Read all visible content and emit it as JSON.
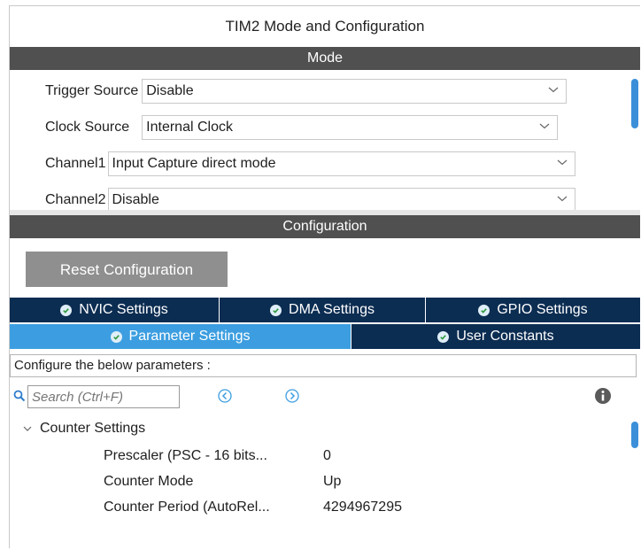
{
  "window": {
    "title": "TIM2 Mode and Configuration"
  },
  "mode": {
    "header": "Mode",
    "rows": [
      {
        "label": "Trigger Source",
        "value": "Disable"
      },
      {
        "label": "Clock Source",
        "value": "Internal Clock"
      },
      {
        "label": "Channel1",
        "value": "Input Capture direct mode"
      },
      {
        "label": "Channel2",
        "value": "Disable"
      }
    ]
  },
  "configuration": {
    "header": "Configuration",
    "reset_label": "Reset Configuration",
    "tabs_top": [
      {
        "label": "NVIC Settings",
        "icon": "check-circle-icon"
      },
      {
        "label": "DMA Settings",
        "icon": "check-circle-icon"
      },
      {
        "label": "GPIO Settings",
        "icon": "check-circle-icon"
      }
    ],
    "tabs_bottom": [
      {
        "label": "Parameter Settings",
        "icon": "check-circle-icon",
        "active": true
      },
      {
        "label": "User Constants",
        "icon": "check-circle-icon",
        "active": false
      }
    ],
    "description": "Configure the below parameters :",
    "search": {
      "placeholder": "Search (Ctrl+F)"
    },
    "tree": {
      "group": "Counter Settings",
      "params": [
        {
          "name": "Prescaler (PSC - 16 bits...",
          "value": "0"
        },
        {
          "name": "Counter Mode",
          "value": "Up"
        },
        {
          "name": "Counter Period (AutoRel...",
          "value": "4294967295"
        }
      ]
    }
  },
  "colors": {
    "section_bar": "#505050",
    "tab_dark": "#0c2d52",
    "tab_active": "#3c9ee0",
    "scroll_thumb": "#3b8fd9",
    "reset_button": "#8f8f8f"
  }
}
